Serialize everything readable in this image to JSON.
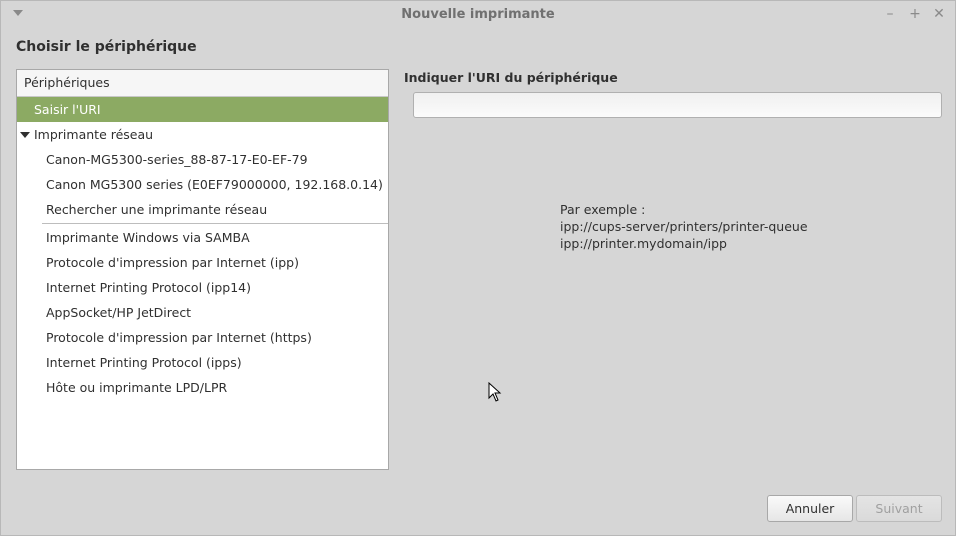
{
  "window": {
    "title": "Nouvelle imprimante"
  },
  "heading": "Choisir le périphérique",
  "devices": {
    "header": "Périphériques",
    "selected": "Saisir l'URI",
    "network_group": "Imprimante réseau",
    "network_items": [
      "Canon-MG5300-series_88-87-17-E0-EF-79",
      "Canon MG5300 series (E0EF79000000, 192.168.0.14)",
      "Rechercher une imprimante réseau"
    ],
    "protocol_items": [
      "Imprimante Windows via SAMBA",
      "Protocole d'impression par Internet (ipp)",
      "Internet Printing Protocol (ipp14)",
      "AppSocket/HP JetDirect",
      "Protocole d'impression par Internet (https)",
      "Internet Printing Protocol (ipps)",
      "Hôte ou imprimante LPD/LPR"
    ]
  },
  "uri": {
    "label": "Indiquer l'URI du périphérique",
    "value": "",
    "example_title": "Par exemple :",
    "example_1": "ipp://cups-server/printers/printer-queue",
    "example_2": "ipp://printer.mydomain/ipp"
  },
  "buttons": {
    "cancel": "Annuler",
    "next": "Suivant"
  },
  "icons": {
    "minimize": "minimize-icon",
    "maximize": "maximize-icon",
    "close": "close-icon"
  },
  "colors": {
    "selection": "#8caa63",
    "background": "#d6d6d6"
  }
}
